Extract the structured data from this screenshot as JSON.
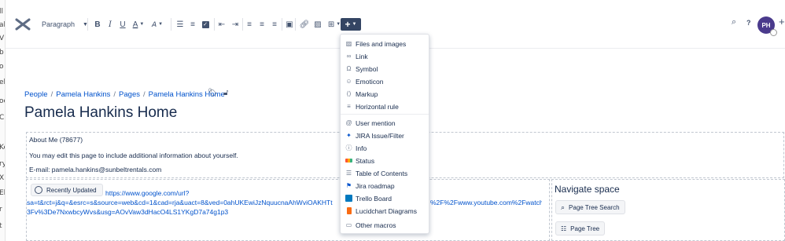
{
  "left_strip": {
    "fragments": [
      "ll",
      "al",
      "VI",
      "b",
      "o",
      "ele",
      "oc",
      "Cl",
      "Ke",
      "ry",
      "X",
      "El",
      "r",
      "t"
    ]
  },
  "toolbar": {
    "paragraph_label": "Paragraph",
    "bold": "B",
    "italic": "I",
    "underline": "U",
    "text_color": "A",
    "insert_button": "+",
    "help": "?",
    "avatar_initials": "PH",
    "add": "+"
  },
  "breadcrumb": {
    "items": [
      "People",
      "Pages",
      "Pamela Hankins Home"
    ],
    "first": "People",
    "second": "Pamela Hankins",
    "third": "Pages",
    "fourth": "Pamela Hankins Home",
    "separator": "/"
  },
  "page": {
    "title": "Pamela Hankins Home"
  },
  "about": {
    "heading": "About Me (78677)",
    "line1": "You may edit this page to include additional information about yourself.",
    "line2": "E-mail: pamela.hankins@sunbeltrentals.com"
  },
  "recent": {
    "button_label": "Recently Updated",
    "url_line1": "https://www.google.com/url?",
    "url_line2_left": "sa=t&rct=j&q=&esrc=s&source=web&cd=1&cad=rja&uact=8&ved=0ahUKEwiJzNquucnaAhWviOAKHTt",
    "url_line2_right": "%2F%2Fwww.youtube.com%2Fwatch%",
    "url_line3": "3Fv%3De7NxwbcyWvs&usg=AOvVaw3dHacO4LS1YKgD7a74g1p3"
  },
  "navigate": {
    "title": "Navigate space",
    "search_button": "Page Tree Search",
    "tree_button": "Page Tree"
  },
  "insert_menu": {
    "items": [
      {
        "label": "Files and images",
        "icon": "image-icon"
      },
      {
        "label": "Link",
        "icon": "link-icon"
      },
      {
        "label": "Symbol",
        "icon": "omega-icon"
      },
      {
        "label": "Emoticon",
        "icon": "smiley-icon"
      },
      {
        "label": "Markup",
        "icon": "braces-icon"
      },
      {
        "label": "Horizontal rule",
        "icon": "rule-icon"
      },
      {
        "label": "User mention",
        "icon": "at-icon"
      },
      {
        "label": "JIRA Issue/Filter",
        "icon": "jira-icon"
      },
      {
        "label": "Info",
        "icon": "info-icon"
      },
      {
        "label": "Status",
        "icon": "status-icon"
      },
      {
        "label": "Table of Contents",
        "icon": "toc-icon"
      },
      {
        "label": "Jira roadmap",
        "icon": "roadmap-icon"
      },
      {
        "label": "Trello Board",
        "icon": "trello-icon"
      },
      {
        "label": "Lucidchart Diagrams",
        "icon": "lucidchart-icon"
      },
      {
        "label": "Other macros",
        "icon": "macros-icon"
      }
    ]
  },
  "colors": {
    "link": "#0052cc",
    "text": "#172b4d",
    "insert_button": "#344563",
    "avatar": "#4a3a8c"
  }
}
